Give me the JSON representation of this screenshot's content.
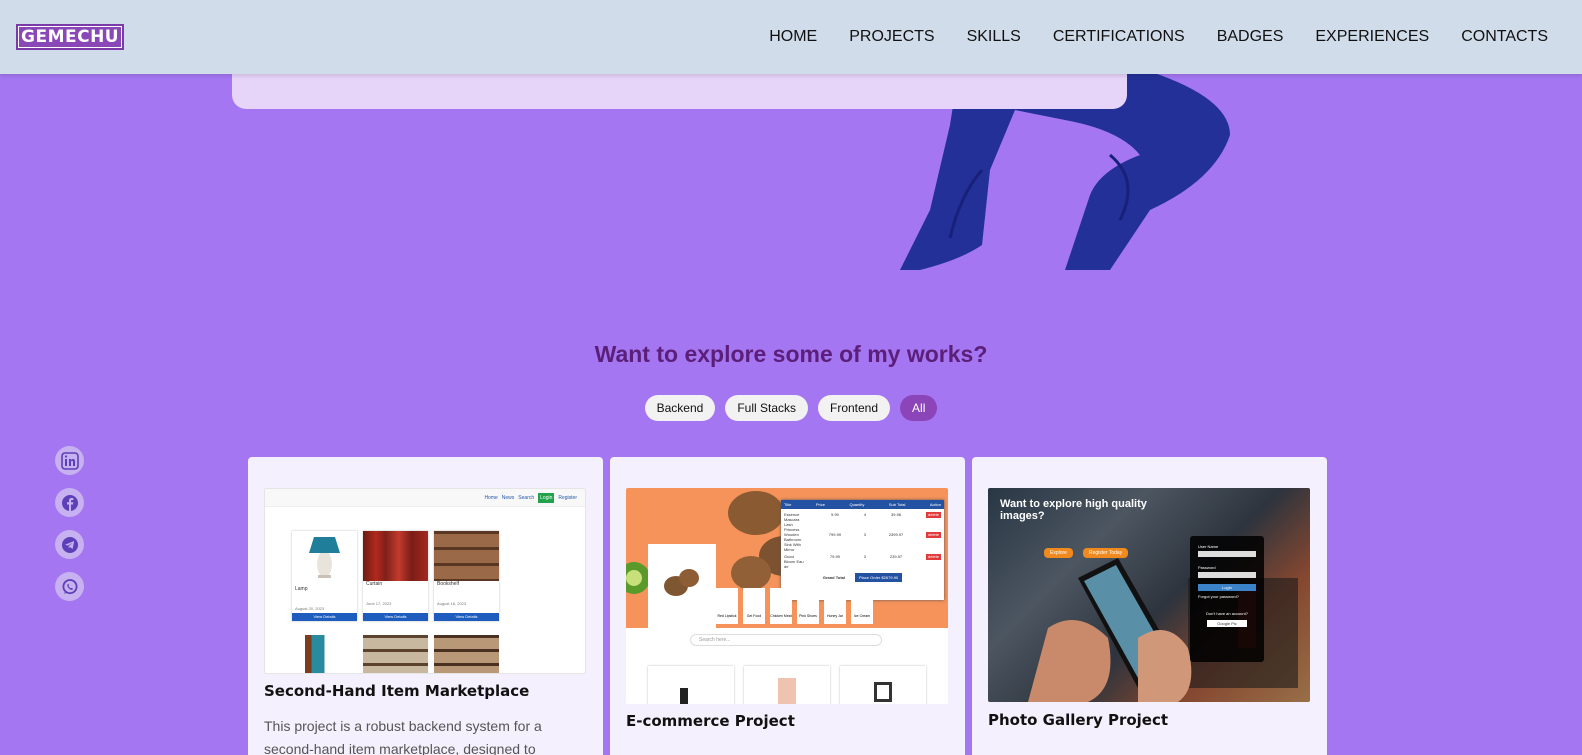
{
  "brand": {
    "logo": "GEMECHU"
  },
  "nav": {
    "items": [
      "HOME",
      "PROJECTS",
      "SKILLS",
      "CERTIFICATIONS",
      "BADGES",
      "EXPERIENCES",
      "CONTACTS"
    ]
  },
  "works": {
    "title": "Want to explore some of my works?",
    "filters": [
      "Backend",
      "Full Stacks",
      "Frontend",
      "All"
    ],
    "active_filter": "All"
  },
  "social": [
    "linkedin-icon",
    "facebook-icon",
    "telegram-icon",
    "whatsapp-icon"
  ],
  "projects": [
    {
      "title": "Second-Hand Item Marketplace",
      "description": "This project is a robust backend system for a second-hand item marketplace, designed to",
      "thumb": {
        "nav": [
          "Home",
          "News",
          "Search",
          "Login",
          "Register"
        ],
        "items": [
          {
            "name": "Lamp",
            "date": "August 20, 2023",
            "btn": "View Details"
          },
          {
            "name": "Curtain",
            "date": "June 17, 2023",
            "btn": "View Details"
          },
          {
            "name": "Bookshelf",
            "date": "August 18, 2023",
            "btn": "View Details"
          }
        ]
      }
    },
    {
      "title": "E-commerce Project",
      "thumb": {
        "cart_headers": [
          "Title",
          "Price",
          "Quantity",
          "Sub Total",
          "Action"
        ],
        "cart_rows": [
          {
            "title": "Essence Mascara Lash Princess",
            "price": "9.99",
            "qty": "4",
            "subtotal": "39.96",
            "action": "delete"
          },
          {
            "title": "Wooden Bathroom Sink With Mirror",
            "price": "799.99",
            "qty": "3",
            "subtotal": "2399.97",
            "action": "delete"
          },
          {
            "title": "Gucci Bloom Eau de",
            "price": "79.99",
            "qty": "3",
            "subtotal": "239.97",
            "action": "delete"
          }
        ],
        "grand_total": "Grand Total",
        "order_btn": "Place Order $2679.90",
        "search_placeholder": "Search here...",
        "products": [
          "Red Lipstick",
          "Gel Food",
          "Chicken Meat",
          "Pink Shoes",
          "Honey Jar",
          "Ice Cream"
        ]
      }
    },
    {
      "title": "Photo Gallery Project",
      "thumb": {
        "headline": "Want to explore high quality images?",
        "explore_btn": "Explore",
        "register_btn": "Register Today",
        "login": {
          "user_label": "User Name",
          "password_label": "Password",
          "login_btn": "Login",
          "forgot": "Forgot your password?",
          "no_account": "Don't have an account?",
          "google_btn": "Google Pic"
        }
      }
    }
  ]
}
